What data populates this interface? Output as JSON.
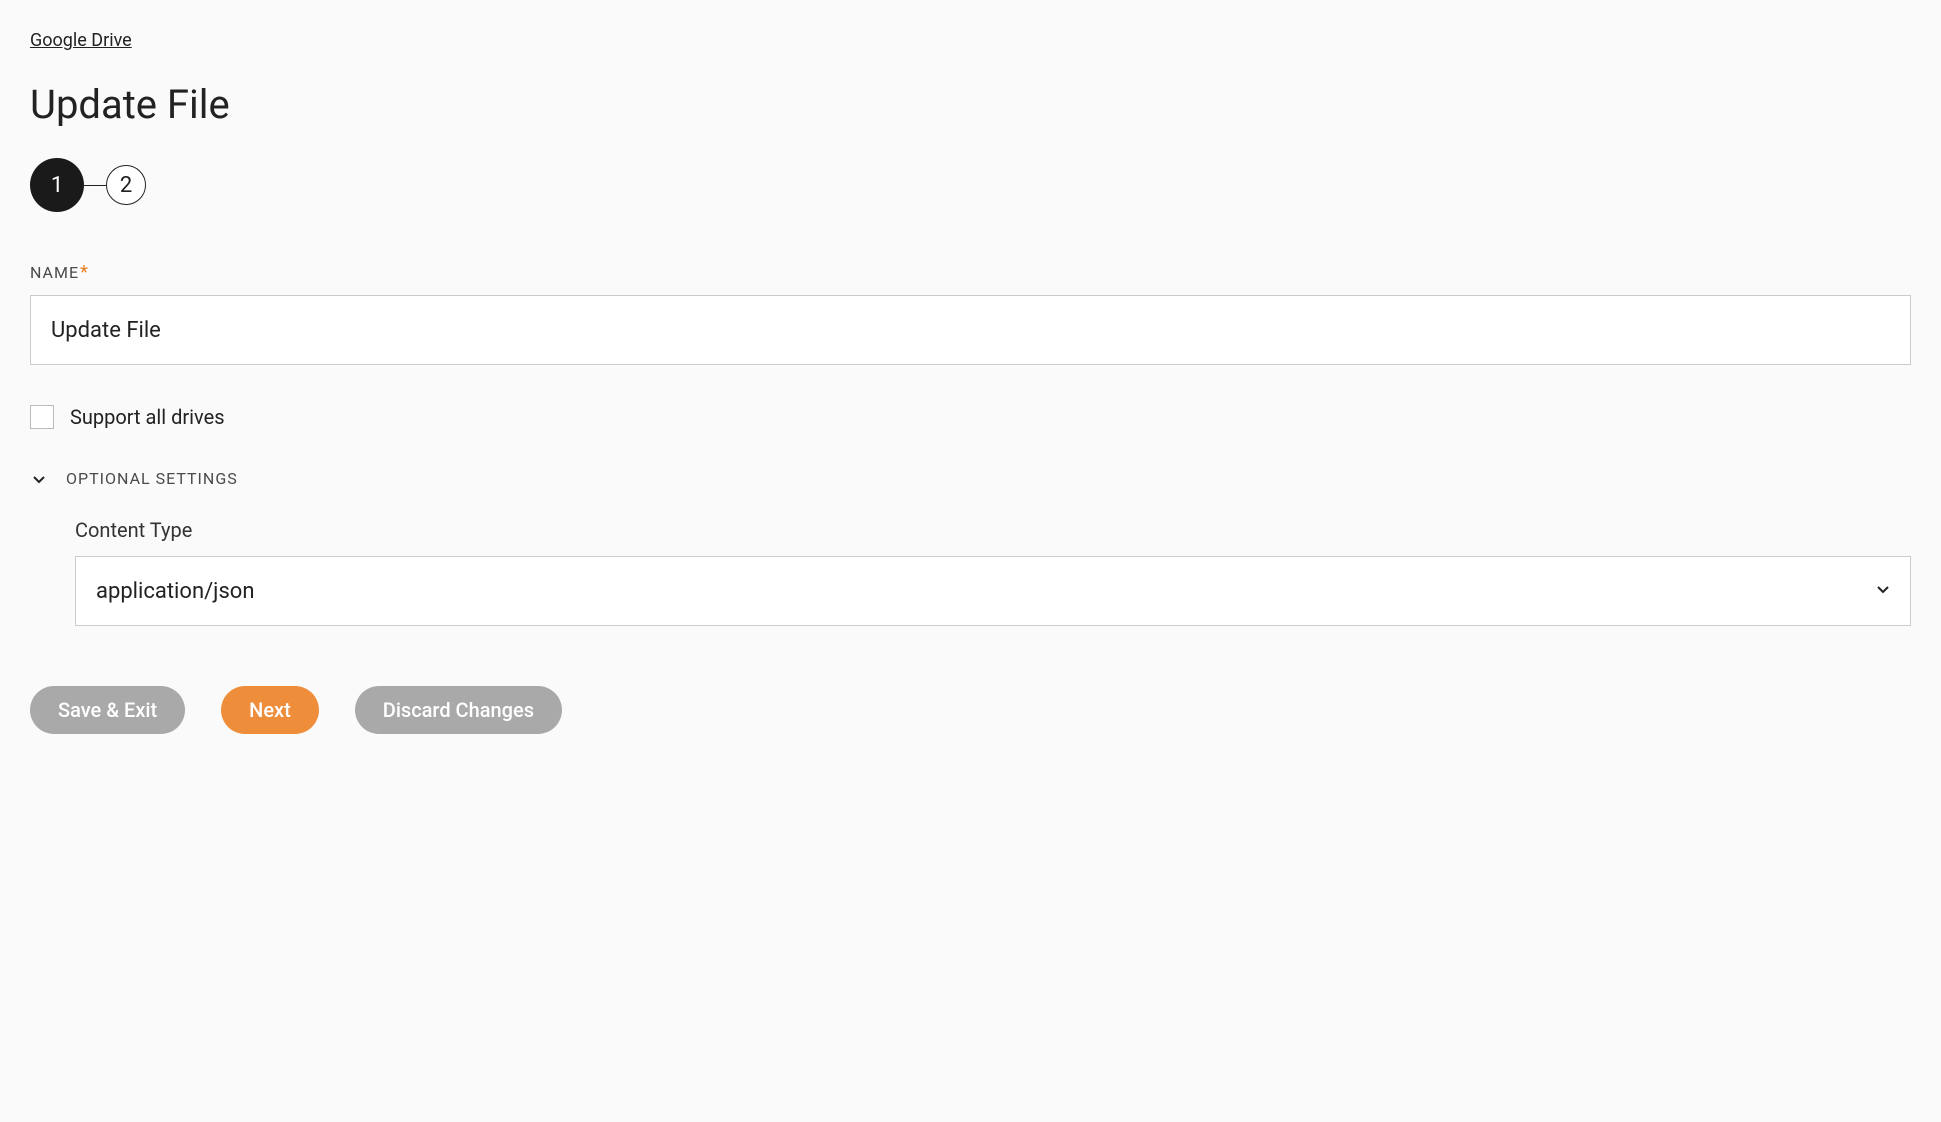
{
  "breadcrumb": "Google Drive",
  "pageTitle": "Update File",
  "stepper": {
    "step1": "1",
    "step2": "2"
  },
  "form": {
    "nameLabel": "NAME",
    "nameValue": "Update File",
    "supportAllDrivesLabel": "Support all drives",
    "supportAllDrivesChecked": false,
    "optionalSettingsLabel": "OPTIONAL SETTINGS",
    "contentTypeLabel": "Content Type",
    "contentTypeValue": "application/json"
  },
  "buttons": {
    "saveExit": "Save & Exit",
    "next": "Next",
    "discard": "Discard Changes"
  }
}
